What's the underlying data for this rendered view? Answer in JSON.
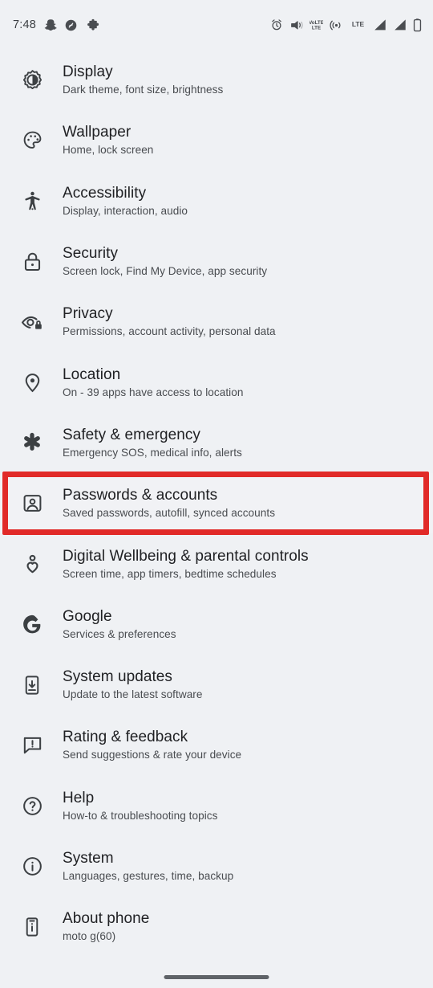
{
  "status_bar": {
    "clock": "7:48",
    "left_icons": [
      {
        "name": "snapchat-icon",
        "label": "Snapchat"
      },
      {
        "name": "shazam-icon",
        "label": "Shazam"
      },
      {
        "name": "puzzle-piece-icon",
        "label": "Puzzle piece"
      }
    ],
    "right_icons": [
      {
        "name": "alarm-clock-icon",
        "label": "Alarm set"
      },
      {
        "name": "vibrate-icon",
        "label": "Vibrate mode"
      },
      {
        "name": "volte-icon",
        "label": "VoLTE"
      },
      {
        "name": "hotspot-icon",
        "label": "Hotspot"
      },
      {
        "name": "lte-label-icon",
        "label": "LTE"
      },
      {
        "name": "signal-bars-1-icon",
        "label": "Signal SIM 1"
      },
      {
        "name": "signal-bars-2-icon",
        "label": "Signal SIM 2"
      },
      {
        "name": "battery-icon",
        "label": "Battery"
      }
    ],
    "volte_text": "VoLTE",
    "lte_text": "LTE"
  },
  "colors": {
    "background": "#eff1f4",
    "title": "#202124",
    "subtitle": "#494c50",
    "icon": "#3c4043",
    "highlight_border": "#e12a28",
    "gesture_bar": "#5f6368"
  },
  "highlight": {
    "target": "Passwords & accounts",
    "border_color": "#e12a28"
  },
  "settings": {
    "items": [
      {
        "icon": "brightness-icon",
        "title": "Display",
        "subtitle": "Dark theme, font size, brightness",
        "highlighted": false
      },
      {
        "icon": "palette-icon",
        "title": "Wallpaper",
        "subtitle": "Home, lock screen",
        "highlighted": false
      },
      {
        "icon": "accessibility-person-icon",
        "title": "Accessibility",
        "subtitle": "Display, interaction, audio",
        "highlighted": false
      },
      {
        "icon": "lock-icon",
        "title": "Security",
        "subtitle": "Screen lock, Find My Device, app security",
        "highlighted": false
      },
      {
        "icon": "eye-lock-icon",
        "title": "Privacy",
        "subtitle": "Permissions, account activity, personal data",
        "highlighted": false
      },
      {
        "icon": "location-pin-icon",
        "title": "Location",
        "subtitle": "On - 39 apps have access to location",
        "highlighted": false
      },
      {
        "icon": "asterisk-icon",
        "title": "Safety & emergency",
        "subtitle": "Emergency SOS, medical info, alerts",
        "highlighted": false
      },
      {
        "icon": "account-badge-icon",
        "title": "Passwords & accounts",
        "subtitle": "Saved passwords, autofill, synced accounts",
        "highlighted": true
      },
      {
        "icon": "person-heart-icon",
        "title": "Digital Wellbeing & parental controls",
        "subtitle": "Screen time, app timers, bedtime schedules",
        "highlighted": false
      },
      {
        "icon": "google-g-icon",
        "title": "Google",
        "subtitle": "Services & preferences",
        "highlighted": false
      },
      {
        "icon": "phone-download-icon",
        "title": "System updates",
        "subtitle": "Update to the latest software",
        "highlighted": false
      },
      {
        "icon": "feedback-bubble-icon",
        "title": "Rating & feedback",
        "subtitle": "Send suggestions & rate your device",
        "highlighted": false
      },
      {
        "icon": "help-circle-icon",
        "title": "Help",
        "subtitle": "How-to & troubleshooting topics",
        "highlighted": false
      },
      {
        "icon": "info-circle-icon",
        "title": "System",
        "subtitle": "Languages, gestures, time, backup",
        "highlighted": false
      },
      {
        "icon": "phone-info-icon",
        "title": "About phone",
        "subtitle": "moto g(60)",
        "highlighted": false
      }
    ]
  },
  "navigation": {
    "gesture_bar": "home-gesture-handle"
  }
}
